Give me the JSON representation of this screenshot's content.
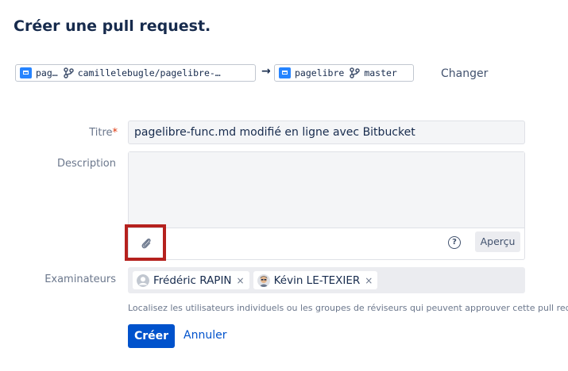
{
  "page": {
    "title": "Créer une pull request."
  },
  "source": {
    "repo": "pag…",
    "branch": "camillelebugle/pagelibre-…"
  },
  "destination": {
    "repo": "pagelibre",
    "branch": "master"
  },
  "arrow": "→",
  "change_label": "Changer",
  "form": {
    "title_label": "Titre",
    "required_marker": "*",
    "title_value": "pagelibre-func.md modifié en ligne avec Bitbucket",
    "description_label": "Description",
    "description_value": "",
    "preview_label": "Aperçu",
    "help_glyph": "?",
    "reviewers_label": "Examinateurs",
    "reviewers": [
      {
        "name": "Frédéric RAPIN",
        "remove": "×"
      },
      {
        "name": "Kévin LE-TEXIER",
        "remove": "×"
      }
    ],
    "hint": "Localisez les utilisateurs individuels ou les groupes de réviseurs qui peuvent approuver cette pull request."
  },
  "actions": {
    "create": "Créer",
    "cancel": "Annuler"
  },
  "colors": {
    "primary": "#0052cc",
    "highlight": "#b5211e",
    "folder": "#2684ff"
  }
}
